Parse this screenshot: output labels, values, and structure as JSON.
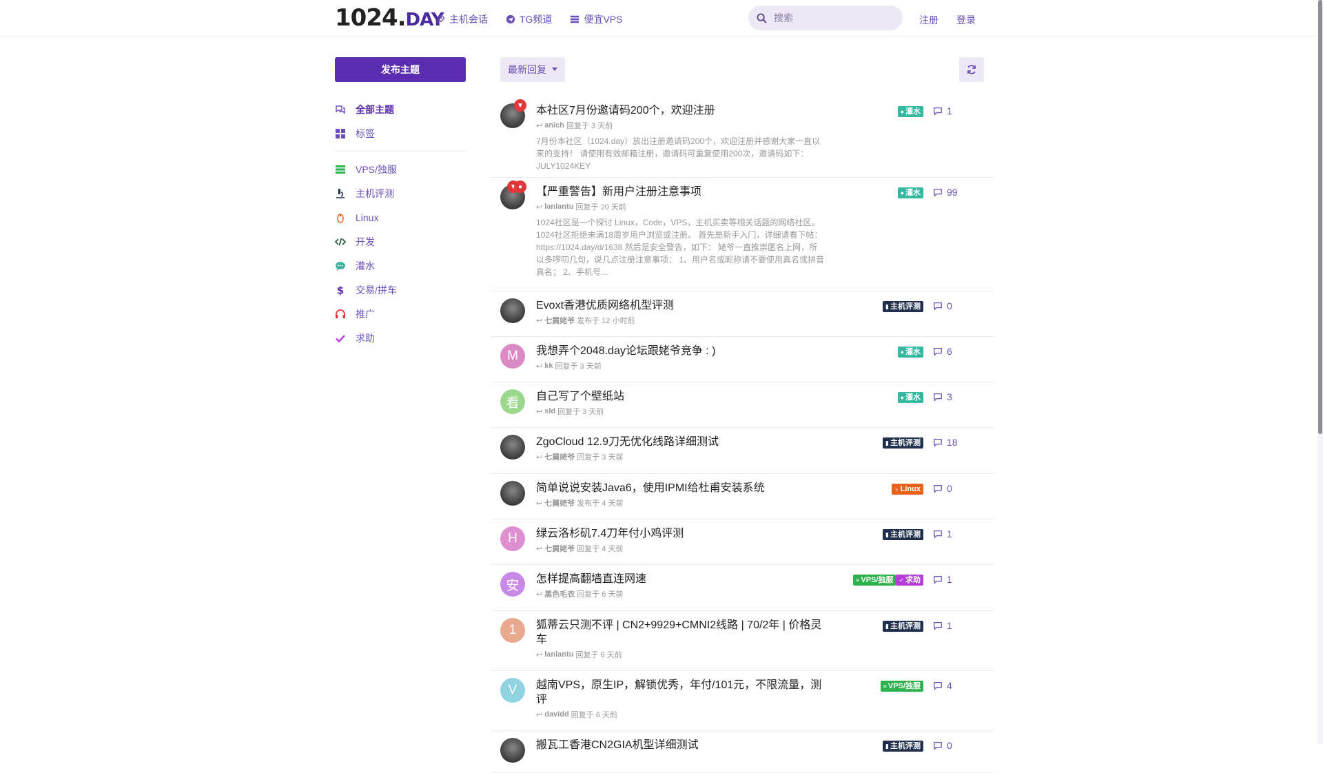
{
  "header": {
    "logo_main": "1024.",
    "logo_suffix": "DAY",
    "nav": [
      {
        "label": "主机会话",
        "icon": "rocket-icon"
      },
      {
        "label": "TG频道",
        "icon": "telegram-icon"
      },
      {
        "label": "便宜VPS",
        "icon": "server-icon"
      }
    ],
    "search_placeholder": "搜索",
    "signup": "注册",
    "login": "登录"
  },
  "sidebar": {
    "new_topic": "发布主题",
    "items": [
      {
        "label": "全部主题",
        "icon": "comments-icon",
        "color": "#6b4fb8",
        "active": true
      },
      {
        "label": "标签",
        "icon": "tags-grid-icon",
        "color": "#6b4fb8"
      },
      {
        "label": "VPS/独服",
        "icon": "server-icon",
        "color": "#2bb24c"
      },
      {
        "label": "主机评测",
        "icon": "microscope-icon",
        "color": "#1f2e4a"
      },
      {
        "label": "Linux",
        "icon": "linux-icon",
        "color": "#e8621a"
      },
      {
        "label": "开发",
        "icon": "code-icon",
        "color": "#2b5e3a"
      },
      {
        "label": "灌水",
        "icon": "chat-bubble-icon",
        "color": "#35b8a0"
      },
      {
        "label": "交易/拼车",
        "icon": "dollar-icon",
        "color": "#5b2bb0"
      },
      {
        "label": "推广",
        "icon": "headset-icon",
        "color": "#e0383a"
      },
      {
        "label": "求助",
        "icon": "check-icon",
        "color": "#b43cd8"
      }
    ]
  },
  "toolbar": {
    "sort_label": "最新回复"
  },
  "colors": {
    "accent": "#5b2bb0",
    "tag_water": "#35b8a0",
    "tag_review": "#1f2e4a",
    "tag_linux": "#e8621a",
    "tag_vps": "#2bb24c",
    "tag_help": "#b43cd8"
  },
  "discussions": [
    {
      "title": "本社区7月份邀请码200个，欢迎注册",
      "user": "anich",
      "action": "回复于 3 天前",
      "excerpt": "7月份本社区（1024.day）放出注册邀请码200个，欢迎注册并感谢大家一直以来的支持！ 请使用有效邮箱注册，邀请码可重复使用200次，邀请码如下： JULY1024KEY",
      "tags": [
        {
          "label": "灌水",
          "type": "water"
        }
      ],
      "replies": "1",
      "avatar": "photo",
      "pins": 1
    },
    {
      "title": "【严重警告】新用户注册注意事项",
      "user": "lanlantu",
      "action": "回复于 20 天前",
      "excerpt": "1024社区是一个探讨 Linux，Code，VPS，主机买卖等相关话题的网络社区。 1024社区拒绝未满18周岁用户浏览或注册。 首先是新手入门，详细请看下帖： https://1024.day/d/1638 然后是安全警告，如下： 姥爷一直推崇匿名上网，所以多啰叨几句，说几点注册注意事项： 1、用户名或昵称请不要使用真名或拼音真名； 2、手机号...",
      "tags": [
        {
          "label": "灌水",
          "type": "water"
        }
      ],
      "replies": "99",
      "avatar": "photo",
      "pins": 2
    },
    {
      "title": "Evoxt香港优质网络机型评测",
      "user": "七舅姥爷",
      "action": "发布于 12 小时前",
      "tags": [
        {
          "label": "主机评测",
          "type": "review"
        }
      ],
      "replies": "0",
      "avatar": "photo"
    },
    {
      "title": "我想弄个2048.day论坛跟姥爷竞争 : )",
      "user": "kk",
      "action": "回复于 3 天前",
      "tags": [
        {
          "label": "灌水",
          "type": "water"
        }
      ],
      "replies": "6",
      "avatar": "M",
      "avatar_color": "#d98ac4"
    },
    {
      "title": "自己写了个壁纸站",
      "user": "sld",
      "action": "回复于 3 天前",
      "tags": [
        {
          "label": "灌水",
          "type": "water"
        }
      ],
      "replies": "3",
      "avatar": "看",
      "avatar_color": "#9bd88e"
    },
    {
      "title": "ZgoCloud 12.9刀无优化线路详细测试",
      "user": "七舅姥爷",
      "action": "回复于 3 天前",
      "tags": [
        {
          "label": "主机评测",
          "type": "review"
        }
      ],
      "replies": "18",
      "avatar": "photo"
    },
    {
      "title": "简单说说安装Java6，使用IPMI给杜甫安装系统",
      "user": "七舅姥爷",
      "action": "发布于 4 天前",
      "tags": [
        {
          "label": "Linux",
          "type": "linux"
        }
      ],
      "replies": "0",
      "avatar": "photo"
    },
    {
      "title": "绿云洛杉矶7.4刀年付小鸡评测",
      "user": "七舅姥爷",
      "action": "回复于 4 天前",
      "tags": [
        {
          "label": "主机评测",
          "type": "review"
        }
      ],
      "replies": "1",
      "avatar": "H",
      "avatar_color": "#df8ed0"
    },
    {
      "title": "怎样提高翻墙直连网速",
      "user": "黑色毛衣",
      "action": "回复于 6 天前",
      "tags": [
        {
          "label": "VPS/独服",
          "type": "vps"
        },
        {
          "label": "求助",
          "type": "help"
        }
      ],
      "replies": "1",
      "avatar": "安",
      "avatar_color": "#c98ae6"
    },
    {
      "title": "狐蒂云只测不评 | CN2+9929+CMNI2线路 | 70/2年 | 价格灵车",
      "user": "lanlantu",
      "action": "回复于 6 天前",
      "tags": [
        {
          "label": "主机评测",
          "type": "review"
        }
      ],
      "replies": "1",
      "avatar": "1",
      "avatar_color": "#e8a98e"
    },
    {
      "title": "越南VPS，原生IP，解锁优秀，年付/101元，不限流量，测评",
      "user": "davidd",
      "action": "回复于 6 天前",
      "tags": [
        {
          "label": "VPS/独服",
          "type": "vps"
        }
      ],
      "replies": "4",
      "avatar": "V",
      "avatar_color": "#8fd2e0"
    },
    {
      "title": "搬瓦工香港CN2GIA机型详细测试",
      "user": "",
      "action": "",
      "tags": [
        {
          "label": "主机评测",
          "type": "review"
        }
      ],
      "replies": "0",
      "avatar": "photo"
    }
  ]
}
